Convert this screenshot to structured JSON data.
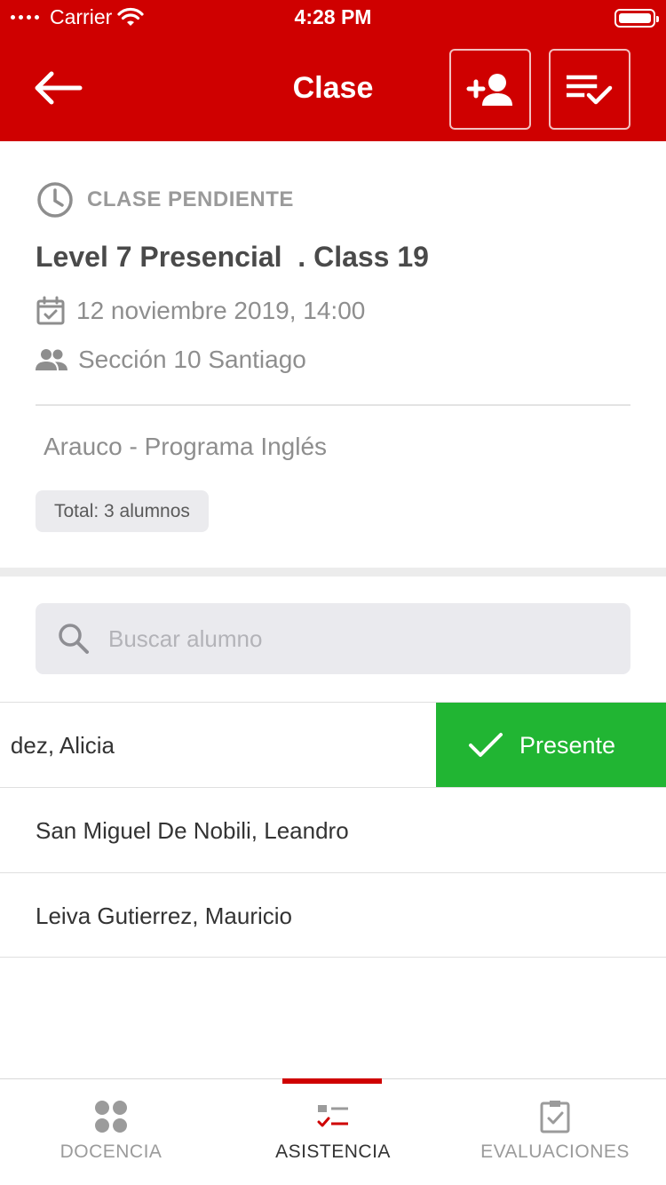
{
  "colors": {
    "brand_red": "#cf0000",
    "present_green": "#21b533",
    "muted_text": "#8e8e8e"
  },
  "status_bar": {
    "carrier": "Carrier",
    "time": "4:28 PM",
    "icons": [
      "signal-dots-icon",
      "wifi-icon",
      "battery-icon"
    ]
  },
  "header": {
    "title": "Clase",
    "back_icon": "arrow-left-icon",
    "actions": [
      {
        "icon": "add-person-icon"
      },
      {
        "icon": "playlist-check-icon"
      }
    ]
  },
  "class_info": {
    "status": "CLASE PENDIENTE",
    "status_icon": "clock-icon",
    "title": "Level 7 Presencial  . Class 19",
    "date": "12 noviembre 2019, 14:00",
    "date_icon": "calendar-check-icon",
    "section": "Sección 10 Santiago",
    "section_icon": "people-icon",
    "program": "Arauco - Programa Inglés",
    "total": "Total: 3 alumnos"
  },
  "search": {
    "placeholder": "Buscar alumno",
    "value": "",
    "icon": "search-icon"
  },
  "students": [
    {
      "name": "dez, Alicia",
      "swiped": true,
      "action_label": "Presente",
      "action_icon": "check-icon"
    },
    {
      "name": "San Miguel De Nobili, Leandro",
      "swiped": false
    },
    {
      "name": "Leiva Gutierrez, Mauricio",
      "swiped": false
    }
  ],
  "tabs": [
    {
      "label": "DOCENCIA",
      "icon": "grid-dots-icon",
      "active": false
    },
    {
      "label": "ASISTENCIA",
      "icon": "checklist-icon",
      "active": true
    },
    {
      "label": "EVALUACIONES",
      "icon": "clipboard-check-icon",
      "active": false
    }
  ]
}
